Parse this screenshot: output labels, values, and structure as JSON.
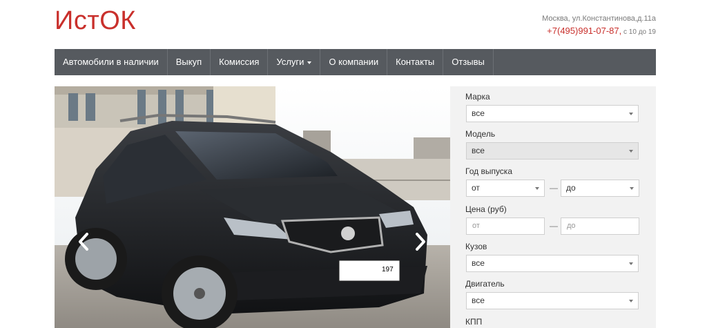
{
  "header": {
    "logo": "ИстОК",
    "address": "Москва, ул.Константинова,д.11а",
    "phone": "+7(495)991-07-87,",
    "hours": " с 10 до 19"
  },
  "nav": {
    "items": [
      {
        "label": "Автомобили в наличии"
      },
      {
        "label": "Выкуп"
      },
      {
        "label": "Комиссия"
      },
      {
        "label": "Услуги"
      },
      {
        "label": "О компании"
      },
      {
        "label": "Контакты"
      },
      {
        "label": "Отзывы"
      }
    ]
  },
  "slider": {
    "plate": "197"
  },
  "filters": {
    "make": {
      "label": "Марка",
      "value": "все"
    },
    "model": {
      "label": "Модель",
      "value": "все"
    },
    "year": {
      "label": "Год выпуска",
      "from": "от",
      "to": "до"
    },
    "price": {
      "label": "Цена (руб)",
      "from_placeholder": "от",
      "to_placeholder": "до"
    },
    "body": {
      "label": "Кузов",
      "value": "все"
    },
    "engine": {
      "label": "Двигатель",
      "value": "все"
    },
    "gearbox": {
      "label": "КПП"
    },
    "dash": "—"
  },
  "colors": {
    "accent": "#c9302c",
    "nav_bg": "#565a5f",
    "panel_bg": "#f2f2f2"
  }
}
